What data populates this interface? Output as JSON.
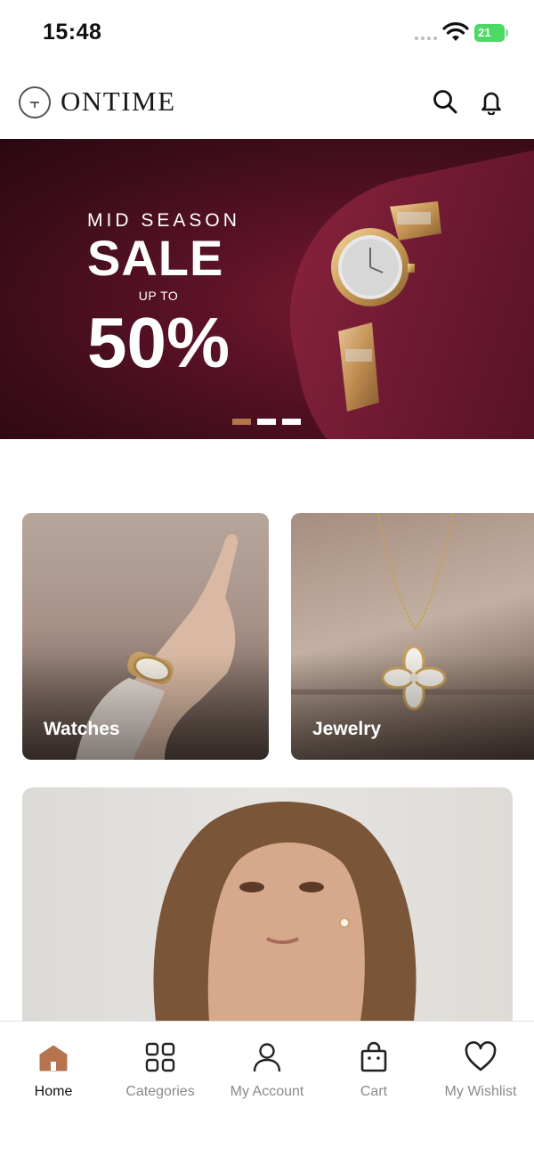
{
  "status_bar": {
    "time": "15:48",
    "battery": "21"
  },
  "header": {
    "brand": "ONTIME",
    "icons": [
      "search-icon",
      "bell-icon"
    ]
  },
  "banner": {
    "eyebrow": "MID SEASON",
    "title": "SALE",
    "upto": "UP TO",
    "discount": "50%",
    "slides_total": 3,
    "active_slide": 1
  },
  "categories": [
    {
      "label": "Watches"
    },
    {
      "label": "Jewelry"
    }
  ],
  "bottom_nav": {
    "active": "Home",
    "items": [
      {
        "label": "Home",
        "icon": "home-icon"
      },
      {
        "label": "Categories",
        "icon": "grid-icon"
      },
      {
        "label": "My Account",
        "icon": "user-icon"
      },
      {
        "label": "Cart",
        "icon": "bag-icon"
      },
      {
        "label": "My Wishlist",
        "icon": "heart-icon"
      }
    ]
  },
  "colors": {
    "accent": "#b5744e",
    "banner_bg": "#5a1226"
  }
}
